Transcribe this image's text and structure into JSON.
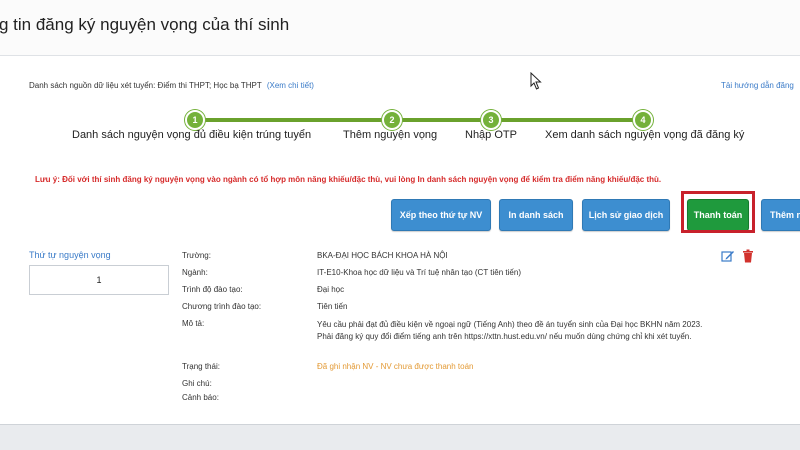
{
  "header": {
    "title": "g tin đăng ký nguyện vọng của thí sinh"
  },
  "source": {
    "label": "Danh sách nguồn dữ liệu xét tuyển: Điểm thi THPT; Học bạ THPT",
    "link": "(Xem chi tiết)"
  },
  "guide_link": "Tải hướng dẫn đăng",
  "steps": [
    {
      "number": "1",
      "label": "Danh sách nguyện vọng đủ điều kiện trúng tuyển"
    },
    {
      "number": "2",
      "label": "Thêm nguyện vọng"
    },
    {
      "number": "3",
      "label": "Nhập OTP"
    },
    {
      "number": "4",
      "label": "Xem danh sách nguyện vọng đã đăng ký"
    }
  ],
  "note": "Lưu ý: Đối với thí sinh đăng ký nguyện vọng vào ngành có tổ hợp môn năng khiếu/đặc thù, vui lòng In danh sách nguyện vọng để kiểm tra điểm năng khiếu/đặc thù.",
  "toolbar": {
    "sort_label": "Xếp theo thứ tự NV",
    "print_label": "In danh sách",
    "history_label": "Lịch sử giao dịch",
    "pay_label": "Thanh toán",
    "add_label": "Thêm n"
  },
  "order": {
    "label": "Thứ tự nguyện vọng",
    "value": "1"
  },
  "details": {
    "school_label": "Trường:",
    "school_value": "BKA-ĐẠI HỌC BÁCH KHOA HÀ NỘI",
    "major_label": "Ngành:",
    "major_value": "IT-E10-Khoa học dữ liệu và Trí tuệ nhân tạo (CT tiên tiến)",
    "level_label": "Trình độ đào tạo:",
    "level_value": "Đại học",
    "program_label": "Chương trình đào tạo:",
    "program_value": "Tiên tiến",
    "desc_label": "Mô tả:",
    "desc_value": "Yêu cầu phải đạt đủ điều kiện về ngoại ngữ (Tiếng Anh) theo đề án tuyển sinh của Đại học BKHN năm 2023. Phải đăng ký quy đổi điểm tiếng anh trên https://xttn.hust.edu.vn/ nếu muốn dùng chứng chỉ khi xét tuyển.",
    "status_label": "Trạng thái:",
    "status_value": "Đã ghi nhận NV - NV chưa được thanh toán",
    "notes_label": "Ghi chú:",
    "warning_label": "Cảnh báo:"
  },
  "bottom_text": "",
  "colors": {
    "accent_blue": "#3d8ed0",
    "pay_green": "#1f9a3d",
    "step_green": "#74b13a",
    "highlight_red": "#c8212b",
    "note_red": "#d62b2b",
    "status_orange": "#e39a35"
  },
  "icons": {
    "edit": "edit-icon",
    "delete": "trash-icon",
    "cursor": "mouse-pointer-icon"
  }
}
